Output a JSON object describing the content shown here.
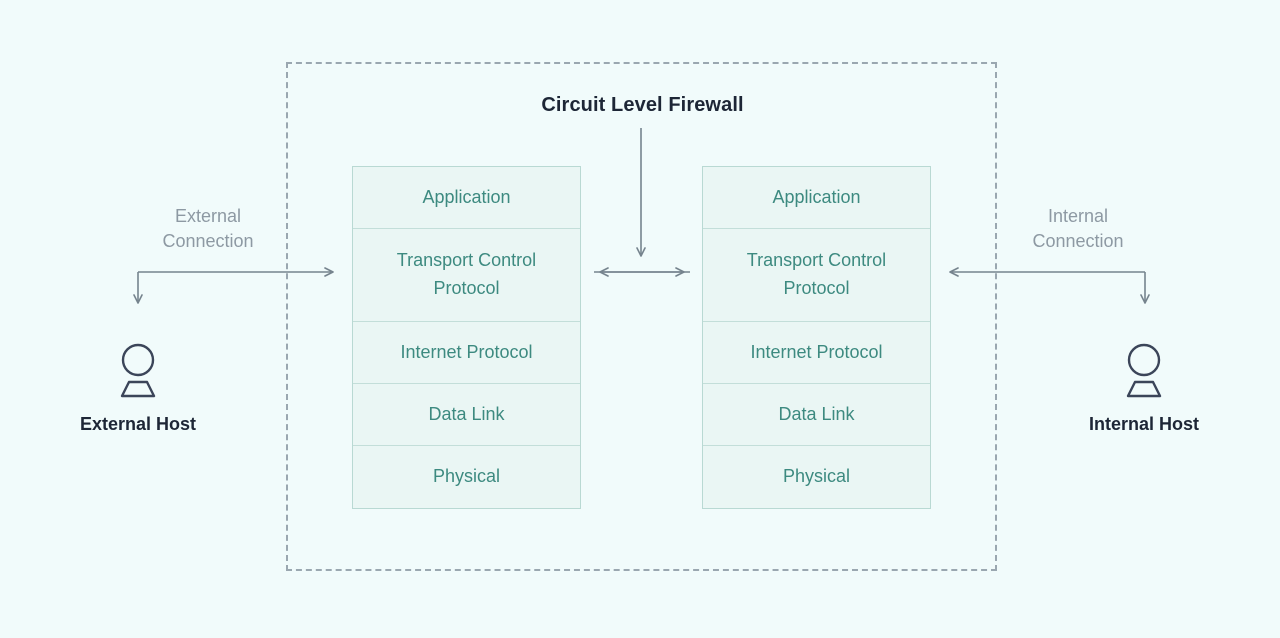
{
  "diagram": {
    "title": "Circuit Level Firewall",
    "background_color": "#f1fbfb",
    "boundary": {
      "name": "firewall-boundary",
      "style": "dashed",
      "color": "#9aa7b0"
    },
    "colors": {
      "title_text": "#1d2636",
      "layer_text": "#3d8a80",
      "layer_fill": "#eaf6f4",
      "layer_border": "#b9d9d3",
      "connection_label_text": "#8d99a3",
      "arrow": "#76848e",
      "host_icon": "#3b4559"
    }
  },
  "stacks": [
    {
      "id": "external-stack",
      "side": "left",
      "layers": [
        {
          "label": "Application"
        },
        {
          "label": "Transport Control Protocol"
        },
        {
          "label": "Internet Protocol"
        },
        {
          "label": "Data Link"
        },
        {
          "label": "Physical"
        }
      ]
    },
    {
      "id": "internal-stack",
      "side": "right",
      "layers": [
        {
          "label": "Application"
        },
        {
          "label": "Transport Control Protocol"
        },
        {
          "label": "Internet Protocol"
        },
        {
          "label": "Data Link"
        },
        {
          "label": "Physical"
        }
      ]
    }
  ],
  "connections": {
    "external": {
      "label": "External\nConnection",
      "direction": "inbound-to-firewall"
    },
    "internal": {
      "label": "Internal\nConnection",
      "direction": "outbound-from-firewall"
    },
    "inter_stack": {
      "direction": "bidirectional"
    },
    "title_pointer": {
      "direction": "down"
    }
  },
  "hosts": [
    {
      "id": "external-host",
      "label": "External Host",
      "icon": "person-icon"
    },
    {
      "id": "internal-host",
      "label": "Internal Host",
      "icon": "person-icon"
    }
  ]
}
